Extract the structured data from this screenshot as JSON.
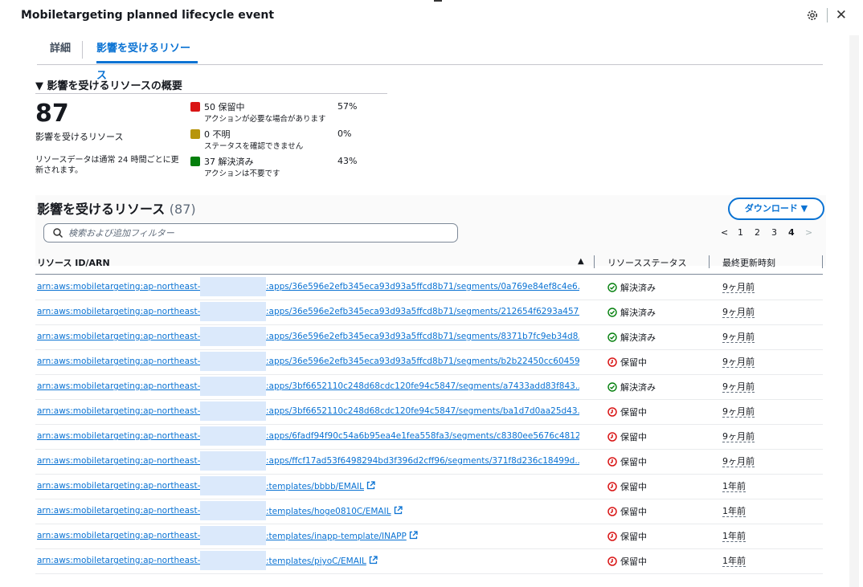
{
  "window": {
    "title": "Mobiletargeting planned lifecycle event",
    "settings_icon": "gear-icon",
    "close_icon": "close-icon",
    "close_glyph": "✕"
  },
  "tabs": [
    {
      "label": "詳細",
      "active": false
    },
    {
      "label": "影響を受けるリソース",
      "active": true
    }
  ],
  "summary": {
    "title": "▼ 影響を受けるリソースの概要",
    "total": "87",
    "total_label": "影響を受けるリソース",
    "note": "リソースデータは通常 24 時間ごとに更新されます。",
    "stats": [
      {
        "label": "50 保留中",
        "sub": "アクションが必要な場合があります",
        "pct": "57%",
        "color": "#d91515",
        "value": 50
      },
      {
        "label": "0 不明",
        "sub": "ステータスを確認できません",
        "pct": "0%",
        "color": "#b7950b",
        "value": 0
      },
      {
        "label": "37 解決済み",
        "sub": "アクションは不要です",
        "pct": "43%",
        "color": "#037f0c",
        "value": 37
      }
    ]
  },
  "table": {
    "title": "影響を受けるリソース",
    "count": "(87)",
    "download_label": "ダウンロード ▼",
    "search_placeholder": "検索および追加フィルター",
    "pagination": {
      "prev": "<",
      "pages": [
        "1",
        "2",
        "3",
        "4"
      ],
      "current": "4",
      "next": ">"
    },
    "columns": {
      "resource": "リソース ID/ARN",
      "sort": "▲",
      "status": "リソースステータス",
      "updated": "最終更新時刻"
    },
    "rows": [
      {
        "arn_prefix": "arn:aws:mobiletargeting:ap-northeast-1",
        "arn_suffix": ":apps/36e596e2efb345eca93d93a5ffcd8b71/segments/0a769e84ef8c4e6...",
        "external": false,
        "status": "解決済み",
        "status_kind": "resolved",
        "updated": "9ヶ月前"
      },
      {
        "arn_prefix": "arn:aws:mobiletargeting:ap-northeast-1",
        "arn_suffix": ":apps/36e596e2efb345eca93d93a5ffcd8b71/segments/212654f6293a457...",
        "external": false,
        "status": "解決済み",
        "status_kind": "resolved",
        "updated": "9ヶ月前"
      },
      {
        "arn_prefix": "arn:aws:mobiletargeting:ap-northeast-1",
        "arn_suffix": ":apps/36e596e2efb345eca93d93a5ffcd8b71/segments/8371b7fc9eb34d8...",
        "external": false,
        "status": "解決済み",
        "status_kind": "resolved",
        "updated": "9ヶ月前"
      },
      {
        "arn_prefix": "arn:aws:mobiletargeting:ap-northeast-1",
        "arn_suffix": ":apps/36e596e2efb345eca93d93a5ffcd8b71/segments/b2b22450cc60459...",
        "external": false,
        "status": "保留中",
        "status_kind": "pending",
        "updated": "9ヶ月前"
      },
      {
        "arn_prefix": "arn:aws:mobiletargeting:ap-northeast-1",
        "arn_suffix": ":apps/3bf6652110c248d68cdc120fe94c5847/segments/a7433add83f843...",
        "external": false,
        "status": "解決済み",
        "status_kind": "resolved",
        "updated": "9ヶ月前"
      },
      {
        "arn_prefix": "arn:aws:mobiletargeting:ap-northeast-1",
        "arn_suffix": ":apps/3bf6652110c248d68cdc120fe94c5847/segments/ba1d7d0aa25d43...",
        "external": false,
        "status": "保留中",
        "status_kind": "pending",
        "updated": "9ヶ月前"
      },
      {
        "arn_prefix": "arn:aws:mobiletargeting:ap-northeast-1",
        "arn_suffix": ":apps/6fadf94f90c54a6b95ea4e1fea558fa3/segments/c8380ee5676c4812...",
        "external": false,
        "status": "保留中",
        "status_kind": "pending",
        "updated": "9ヶ月前"
      },
      {
        "arn_prefix": "arn:aws:mobiletargeting:ap-northeast-1",
        "arn_suffix": ":apps/ffcf17ad53f6498294bd3f396d2cff96/segments/371f8d236c18499d...",
        "external": false,
        "status": "保留中",
        "status_kind": "pending",
        "updated": "9ヶ月前"
      },
      {
        "arn_prefix": "arn:aws:mobiletargeting:ap-northeast-1",
        "arn_suffix": ":templates/bbbb/EMAIL",
        "external": true,
        "status": "保留中",
        "status_kind": "pending",
        "updated": "1年前"
      },
      {
        "arn_prefix": "arn:aws:mobiletargeting:ap-northeast-1",
        "arn_suffix": ":templates/hoge0810C/EMAIL",
        "external": true,
        "status": "保留中",
        "status_kind": "pending",
        "updated": "1年前"
      },
      {
        "arn_prefix": "arn:aws:mobiletargeting:ap-northeast-1",
        "arn_suffix": ":templates/inapp-template/INAPP",
        "external": true,
        "status": "保留中",
        "status_kind": "pending",
        "updated": "1年前"
      },
      {
        "arn_prefix": "arn:aws:mobiletargeting:ap-northeast-1",
        "arn_suffix": ":templates/piyoC/EMAIL",
        "external": true,
        "status": "保留中",
        "status_kind": "pending",
        "updated": "1年前"
      }
    ]
  },
  "colors": {
    "link": "#0972d3",
    "resolved": "#037f0c",
    "pending": "#d91515",
    "redaction": "#dbe9fb"
  }
}
